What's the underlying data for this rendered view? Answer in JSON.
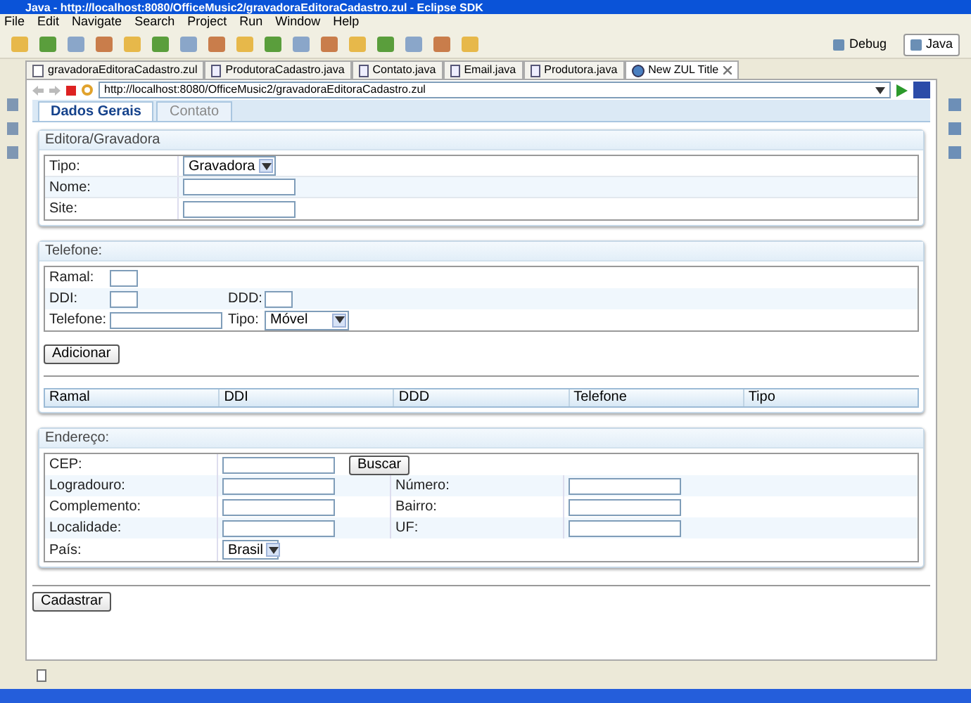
{
  "window": {
    "title": "Java - http://localhost:8080/OfficeMusic2/gravadoraEditoraCadastro.zul - Eclipse SDK"
  },
  "menu": [
    "File",
    "Edit",
    "Navigate",
    "Search",
    "Project",
    "Run",
    "Window",
    "Help"
  ],
  "perspectives": [
    {
      "label": "Debug",
      "selected": false
    },
    {
      "label": "Java",
      "selected": true
    }
  ],
  "editor_tabs": [
    {
      "label": "gravadoraEditoraCadastro.zul",
      "kind": "zul",
      "selected": false
    },
    {
      "label": "ProdutoraCadastro.java",
      "kind": "java",
      "selected": false
    },
    {
      "label": "Contato.java",
      "kind": "java",
      "selected": false
    },
    {
      "label": "Email.java",
      "kind": "java",
      "selected": false
    },
    {
      "label": "Produtora.java",
      "kind": "java",
      "selected": false
    },
    {
      "label": "New ZUL Title",
      "kind": "web",
      "selected": true
    }
  ],
  "browser": {
    "url": "http://localhost:8080/OfficeMusic2/gravadoraEditoraCadastro.zul"
  },
  "page_tabs": [
    {
      "label": "Dados Gerais",
      "selected": true
    },
    {
      "label": "Contato",
      "selected": false
    }
  ],
  "editora": {
    "title": "Editora/Gravadora",
    "rows": [
      {
        "label": "Tipo:",
        "kind": "select",
        "value": "Gravadora"
      },
      {
        "label": "Nome:",
        "kind": "input"
      },
      {
        "label": "Site:",
        "kind": "input"
      }
    ]
  },
  "telefone": {
    "title": "Telefone:",
    "ramal": {
      "label": "Ramal:"
    },
    "ddi": {
      "label": "DDI:"
    },
    "ddd": {
      "label": "DDD:"
    },
    "telefone": {
      "label": "Telefone:"
    },
    "tipo": {
      "label": "Tipo:",
      "value": "Móvel"
    },
    "add_button": "Adicionar",
    "columns": [
      "Ramal",
      "DDI",
      "DDD",
      "Telefone",
      "Tipo"
    ]
  },
  "endereco": {
    "title": "Endereço:",
    "cep": {
      "label": "CEP:",
      "button": "Buscar"
    },
    "rows": [
      {
        "left": "Logradouro:",
        "right": "Número:"
      },
      {
        "left": "Complemento:",
        "right": "Bairro:"
      },
      {
        "left": "Localidade:",
        "right": "UF:"
      }
    ],
    "pais": {
      "label": "País:",
      "value": "Brasil"
    }
  },
  "submit_button": "Cadastrar"
}
